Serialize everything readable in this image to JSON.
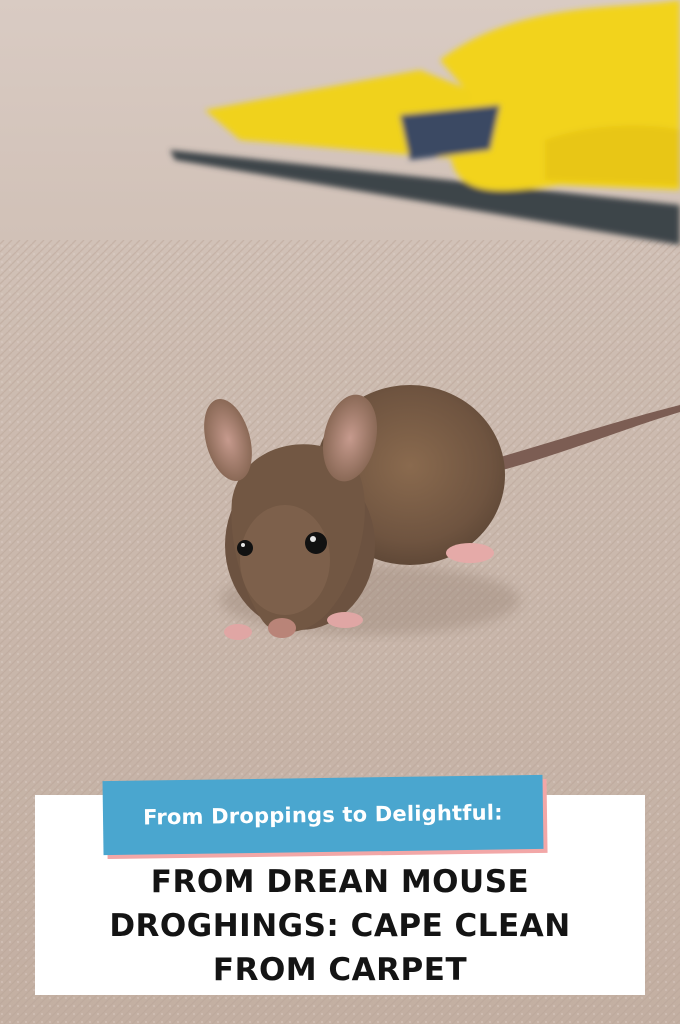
{
  "image": {
    "description_icon": "photo-mouse-on-carpet",
    "colors": {
      "carpet": "#cbb8ab",
      "glove": "#f2d21a",
      "tag_background": "#4aa6cf",
      "tag_shadow": "#f2a7a7",
      "card_background": "#ffffff",
      "headline_text": "#141414"
    }
  },
  "caption": {
    "tag": "From Droppings to Delightful:",
    "headline_lines": [
      "FROM DREAN MOUSE",
      "DROGНINGS: CAPE CLEAN",
      "FROM CARPET"
    ]
  }
}
